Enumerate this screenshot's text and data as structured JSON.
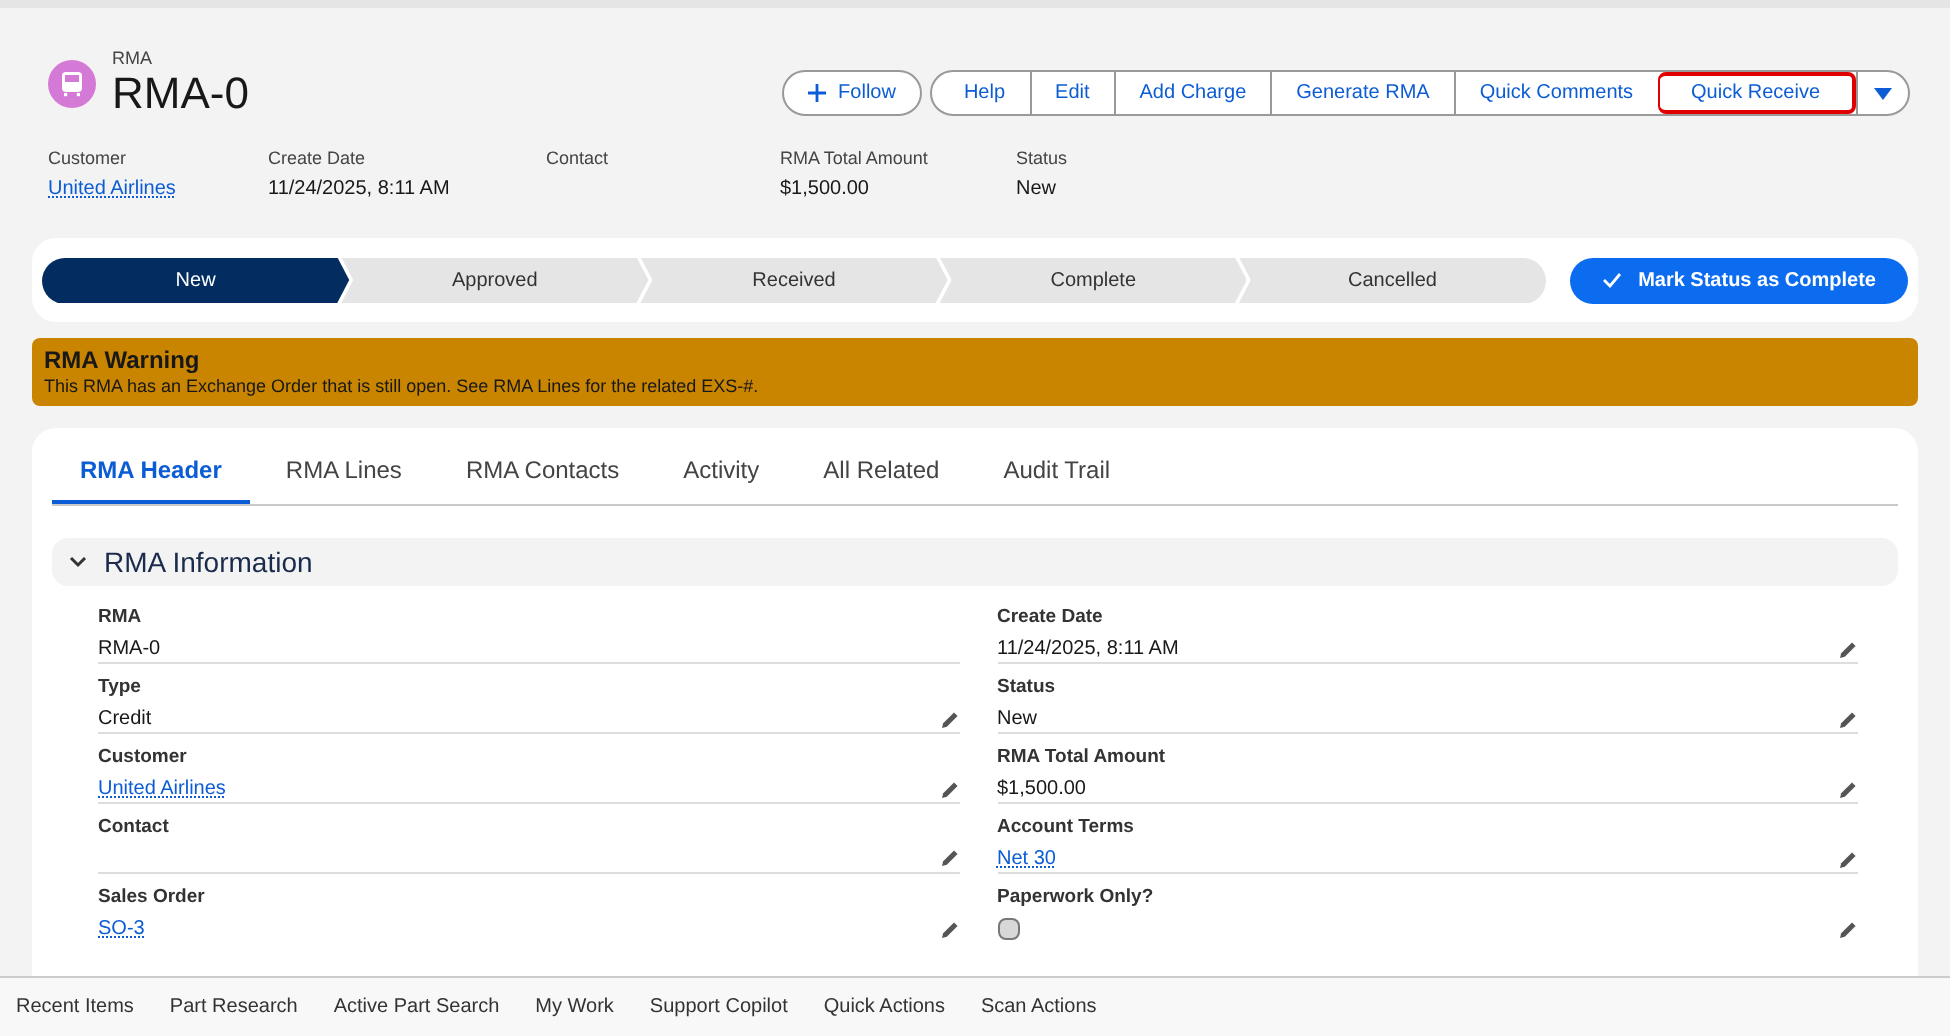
{
  "record": {
    "object_label": "RMA",
    "title": "RMA-0"
  },
  "actions": {
    "follow": "Follow",
    "buttons": [
      {
        "label": "Help",
        "highlighted": false
      },
      {
        "label": "Edit",
        "highlighted": false
      },
      {
        "label": "Add Charge",
        "highlighted": false
      },
      {
        "label": "Generate RMA",
        "highlighted": false
      },
      {
        "label": "Quick Comments",
        "highlighted": false
      },
      {
        "label": "Quick Receive",
        "highlighted": true
      }
    ]
  },
  "highlights": [
    {
      "label": "Customer",
      "value": "United Airlines",
      "kind": "link"
    },
    {
      "label": "Create Date",
      "value": "11/24/2025, 8:11 AM",
      "kind": "text"
    },
    {
      "label": "Contact"
    },
    {
      "label": "RMA Total Amount",
      "value": "$1,500.00",
      "kind": "text"
    },
    {
      "label": "Status",
      "value": "New",
      "kind": "text"
    }
  ],
  "path": {
    "steps": [
      {
        "label": "New",
        "selected": true
      },
      {
        "label": "Approved",
        "selected": false
      },
      {
        "label": "Received",
        "selected": false
      },
      {
        "label": "Complete",
        "selected": false
      },
      {
        "label": "Cancelled",
        "selected": false
      }
    ],
    "button": "Mark Status as Complete"
  },
  "warning": {
    "title": "RMA Warning",
    "message": "This RMA has an Exchange Order that is still open. See RMA Lines for the related EXS-#."
  },
  "tabs": [
    {
      "label": "RMA Header",
      "selected": true
    },
    {
      "label": "RMA Lines",
      "selected": false
    },
    {
      "label": "RMA Contacts",
      "selected": false
    },
    {
      "label": "Activity",
      "selected": false
    },
    {
      "label": "All Related",
      "selected": false
    },
    {
      "label": "Audit Trail",
      "selected": false
    }
  ],
  "section": {
    "title": "RMA Information",
    "expanded": true,
    "fields": [
      {
        "label": "RMA",
        "value": "RMA-0",
        "kind": "text",
        "editable": false
      },
      {
        "label": "Create Date",
        "value": "11/24/2025, 8:11 AM",
        "kind": "text",
        "editable": true
      },
      {
        "label": "Type",
        "value": "Credit",
        "kind": "text",
        "editable": true
      },
      {
        "label": "Status",
        "value": "New",
        "kind": "text",
        "editable": true
      },
      {
        "label": "Customer",
        "value": "United Airlines",
        "kind": "link",
        "editable": true
      },
      {
        "label": "RMA Total Amount",
        "value": "$1,500.00",
        "kind": "text",
        "editable": true
      },
      {
        "label": "Contact",
        "kind": "text",
        "editable": true
      },
      {
        "label": "Account Terms",
        "value": "Net 30",
        "kind": "link",
        "editable": true
      },
      {
        "label": "Sales Order",
        "value": "SO-3",
        "kind": "link",
        "editable": true
      },
      {
        "label": "Paperwork Only?",
        "kind": "checkbox",
        "checked": false,
        "editable": true
      }
    ]
  },
  "utility_bar": [
    "Recent Items",
    "Part Research",
    "Active Part Search",
    "My Work",
    "Support Copilot",
    "Quick Actions",
    "Scan Actions"
  ]
}
